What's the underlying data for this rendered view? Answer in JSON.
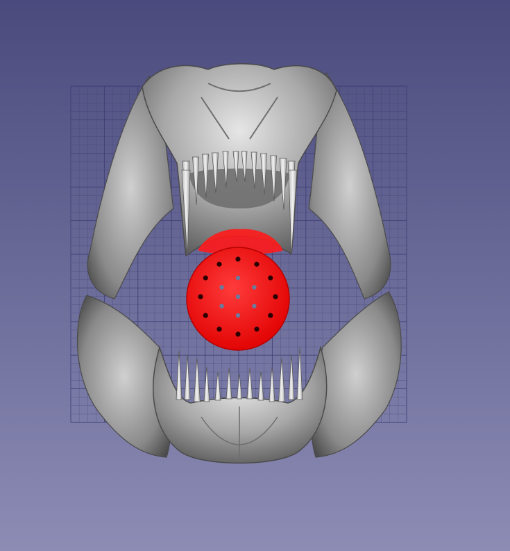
{
  "viewport": {
    "background_top": "#4a4a7d",
    "background_bottom": "#8c8cb5"
  },
  "grid": {
    "color": "#3c3c72",
    "major_divisions": 10,
    "minor_divisions_per_major": 4
  },
  "skull": {
    "icon": "skull-model-icon",
    "color": "#9e9e9e",
    "highlight": "#d8d8d8",
    "shadow": "#555555"
  },
  "selection": {
    "icon": "filter-disc-icon",
    "color": "#ff1a1a",
    "hole_color": "#2a0000",
    "hole_rings": [
      1,
      6,
      12
    ]
  }
}
